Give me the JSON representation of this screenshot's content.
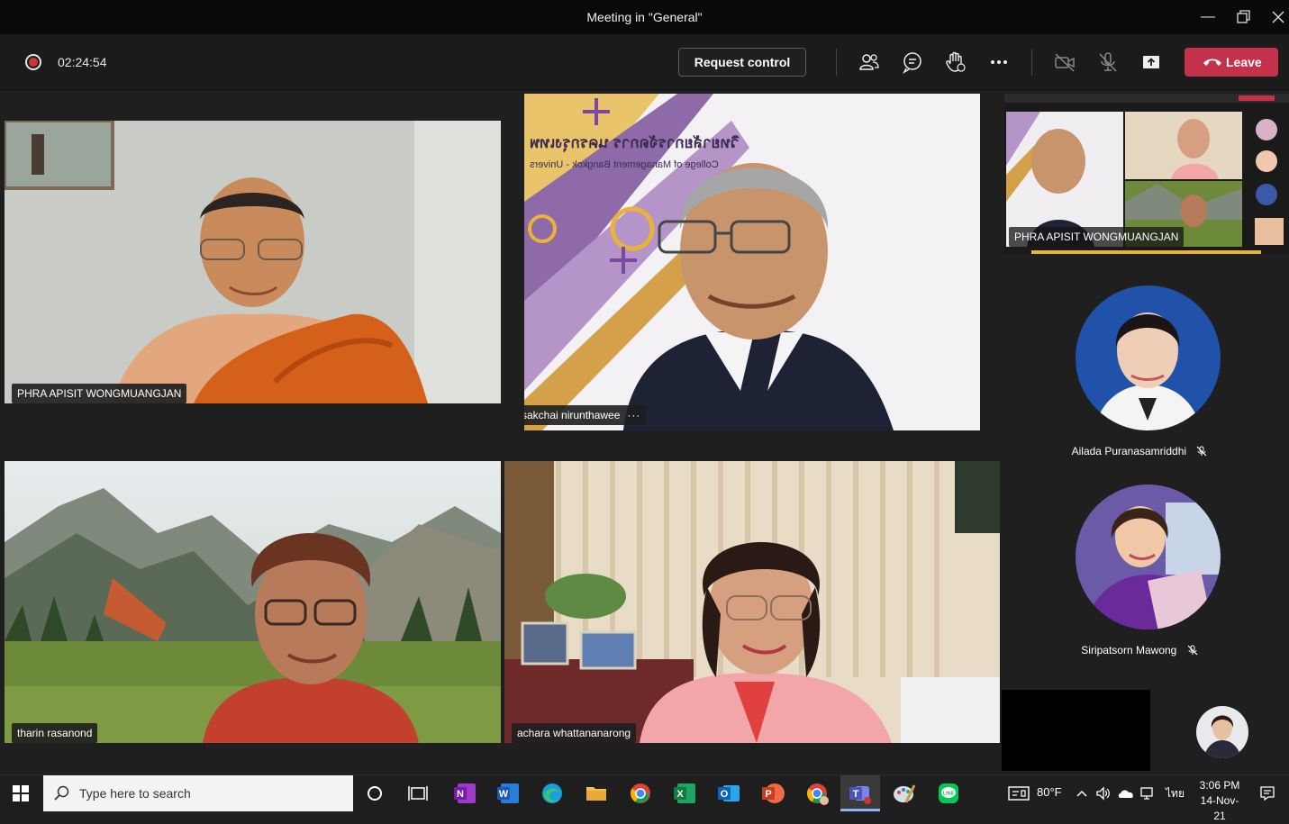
{
  "window": {
    "title": "Meeting in \"General\""
  },
  "toolbar": {
    "timer": "02:24:54",
    "request_control_label": "Request control",
    "leave_label": "Leave",
    "icons": [
      "people-icon",
      "chat-icon",
      "raise-hand-icon",
      "more-options-icon",
      "camera-off-icon",
      "mic-off-icon",
      "share-tray-icon",
      "hangup-icon"
    ]
  },
  "participants": [
    {
      "name": "PHRA APISIT WONGMUANGJAN"
    },
    {
      "name": "sakchai nirunthawee"
    },
    {
      "name": "tharin rasanond"
    },
    {
      "name": "achara whattananarong"
    }
  ],
  "background_text": {
    "line1": "วิทยาลัยการจัดการ นครกรุงเทพ",
    "line2": "College of Management Bangkok - Univers"
  },
  "shared_screen": {
    "presenter_label": "PHRA APISIT WONGMUANGJAN"
  },
  "side_participants": [
    {
      "name": "Ailada Puranasamriddhi",
      "muted": true
    },
    {
      "name": "Siripatsorn Mawong",
      "muted": true
    }
  ],
  "taskbar": {
    "search_placeholder": "Type here to search",
    "weather": "80°F",
    "language": "ไทย",
    "time": "3:06 PM",
    "date": "14-Nov-21",
    "apps": [
      "onenote-icon",
      "word-icon",
      "edge-icon",
      "file-explorer-icon",
      "chrome-icon",
      "excel-icon",
      "outlook-icon",
      "powerpoint-icon",
      "chrome-profile-icon",
      "teams-icon",
      "paint-icon",
      "line-icon"
    ]
  }
}
